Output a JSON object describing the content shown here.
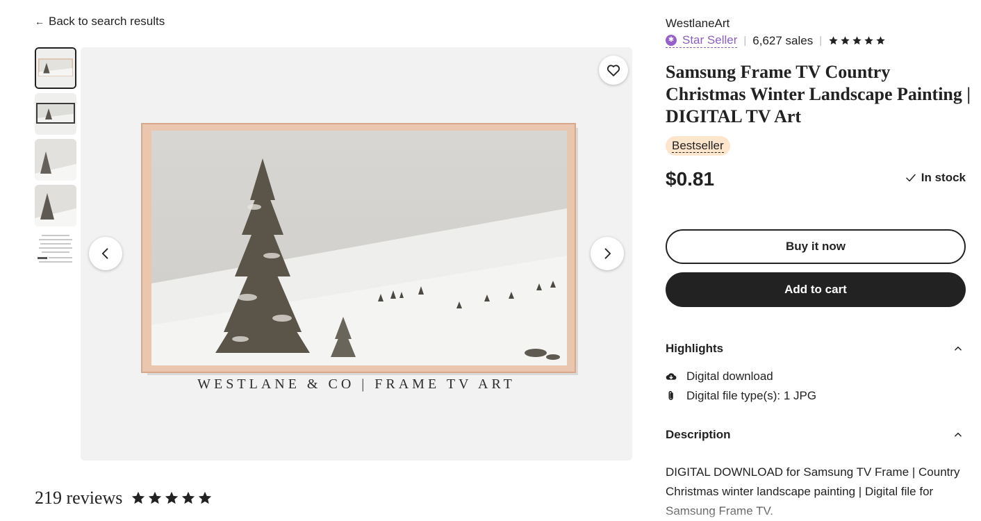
{
  "nav": {
    "back_label": "Back to search results"
  },
  "gallery": {
    "brand_caption": "WESTLANE & CO | FRAME TV ART",
    "thumbnail_count": 5
  },
  "reviews": {
    "count_label": "219 reviews",
    "rating_stars": 5
  },
  "shop": {
    "name": "WestlaneArt",
    "star_seller_label": "Star Seller",
    "sales_label": "6,627 sales",
    "rating_stars": 5
  },
  "product": {
    "title": "Samsung Frame TV Country Christmas Winter Landscape Painting | DIGITAL TV Art",
    "badge": "Bestseller",
    "price": "$0.81",
    "stock_label": "In stock"
  },
  "actions": {
    "buy_label": "Buy it now",
    "cart_label": "Add to cart"
  },
  "highlights": {
    "heading": "Highlights",
    "items": [
      {
        "icon": "cloud-download-icon",
        "label": "Digital download"
      },
      {
        "icon": "paperclip-icon",
        "label": "Digital file type(s): 1 JPG"
      }
    ]
  },
  "description": {
    "heading": "Description",
    "text": "DIGITAL DOWNLOAD for Samsung TV Frame | Country Christmas winter landscape painting | Digital file for Samsung Frame TV."
  },
  "colors": {
    "accent_purple": "#8b5fbf",
    "bestseller_bg": "#fde6cc",
    "primary_dark": "#222222"
  }
}
